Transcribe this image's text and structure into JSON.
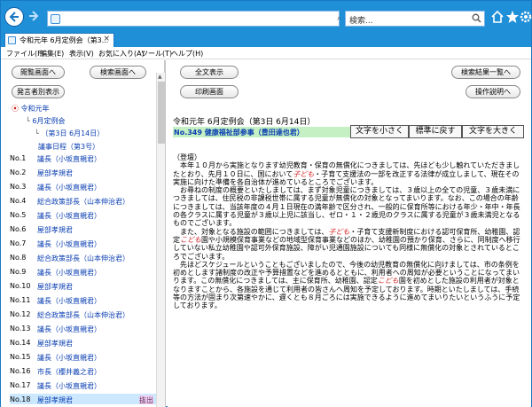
{
  "browser": {
    "search_placeholder": "検索...",
    "tab_title": "令和元年 6月定例会（第3...",
    "tab_close": "×"
  },
  "menu": {
    "items": [
      "ファイル(F)",
      "編集(E)",
      "表示(V)",
      "お気に入り(A)",
      "ツール(T)",
      "ヘルプ(H)"
    ]
  },
  "left": {
    "buttons": {
      "meeting_list": "閲覧画面へ",
      "search_screen": "検索画面へ",
      "speaker_list": "発言者別表示"
    },
    "tree": {
      "year": "令和元年",
      "session": "6月定例会",
      "day": "（第3日 6月14日）",
      "agenda": "議事日程（第3号）"
    },
    "minutes": [
      {
        "num": "No.1",
        "speaker": "議長（小坂直親君）"
      },
      {
        "num": "No.2",
        "speaker": "屋部孝規君"
      },
      {
        "num": "No.3",
        "speaker": "議長（小坂直親君）"
      },
      {
        "num": "No.4",
        "speaker": "総合政策部長（山本伸治君）"
      },
      {
        "num": "No.5",
        "speaker": "議長（小坂直親君）"
      },
      {
        "num": "No.6",
        "speaker": "屋部孝規君"
      },
      {
        "num": "No.7",
        "speaker": "議長（小坂直親君）"
      },
      {
        "num": "No.8",
        "speaker": "総合政策部長（山本伸治君）"
      },
      {
        "num": "No.9",
        "speaker": "議長（小坂直親君）"
      },
      {
        "num": "No.10",
        "speaker": "屋部孝規君"
      },
      {
        "num": "No.11",
        "speaker": "議長（小坂直親君）"
      },
      {
        "num": "No.12",
        "speaker": "総合政策部長（山本伸治君）"
      },
      {
        "num": "No.13",
        "speaker": "議長（小坂直親君）"
      },
      {
        "num": "No.14",
        "speaker": "屋部孝規君"
      },
      {
        "num": "No.15",
        "speaker": "議長（小坂直親君）"
      },
      {
        "num": "No.16",
        "speaker": "市長（櫻井義之君）"
      },
      {
        "num": "No.17",
        "speaker": "議長（小坂直親君）"
      },
      {
        "num": "No.18",
        "speaker": "屋部孝規君"
      }
    ],
    "partial_badge": "抜出"
  },
  "right": {
    "buttons": {
      "full_text": "全文表示",
      "print_screen": "印刷画面",
      "search_results": "検索結果一覧へ",
      "help": "操作説明へ"
    },
    "meeting_title": "令和元年 6月定例会（第3日 6月14日）",
    "speaker_label": "No.349 健康福祉部参事（豊田達也君）",
    "font_buttons": {
      "smaller": "文字を小さく",
      "reset": "標準に戻す",
      "larger": "文字を大きく"
    },
    "body": {
      "heading": "（登壇）",
      "p1a": "本年１０月から実施となります幼児教育・保育の無償化につきましては、先ほども少し触れていただきましたとおり、先月１０日に、国において",
      "hl1": "子ども",
      "p1b": "・子育て支援法の一部を改正する法律が成立しまして、現在その実施に向けた準備を各自治体が進めているところでございます。",
      "p2": "お尋ねの制度の概要といたしましては、まず対象児童につきましては、３歳以上の全ての児童、３歳未満につきましては、住民税の非課税世帯に属する児童が無償化の対象となってまいります。なお、この場合の年齢につきましては、当該年度の４月１日現在の満年齢で区分され、一般的に保育所等における年少・年中・年長の各クラスに属する児童が３歳以上児に該当し、ゼロ・１・２歳児のクラスに属する児童が３歳未満児となるものでございます。",
      "p3a": "また、対象となる施設の範囲につきましては、",
      "hl2": "子ども",
      "p3b": "・子育て支援新制度における認可保育所、幼稚園、認定",
      "hl3": "こども",
      "p3c": "園や小規模保育事業などの地域型保育事業などのほか、幼稚園の預かり保育、さらに、同制度へ移行していない私立幼稚園や認可外保育施設、障がい児通園施設についても同様に無償化の対象とされているところでございます。",
      "p4a": "先ほどスケジュールということもございましたので、今後の幼児教育の無償化に向けましては、市の条例を初めとします諸制度の改正や予算措置などを進めるとともに、利用者への周知が必要ということになってまいります。この無償化につきましては、主に保育所、幼稚園、認定",
      "hl4": "こども",
      "p4b": "園を初めとした施設の利用者が対象となりますことから、各施設を通じて利用者の皆さんへ周知を予定しております。時期といたしましては、手続等の方法が固まり次第速やかに、遅くとも８月ごろには実施できるように進めてまいりたいというふうに予定しております。"
    }
  },
  "colors": {
    "accent": "#1f8fd8",
    "link": "#0b3fb2",
    "highlight": "#d42020",
    "speaker_bar": "#c4f0c4"
  }
}
